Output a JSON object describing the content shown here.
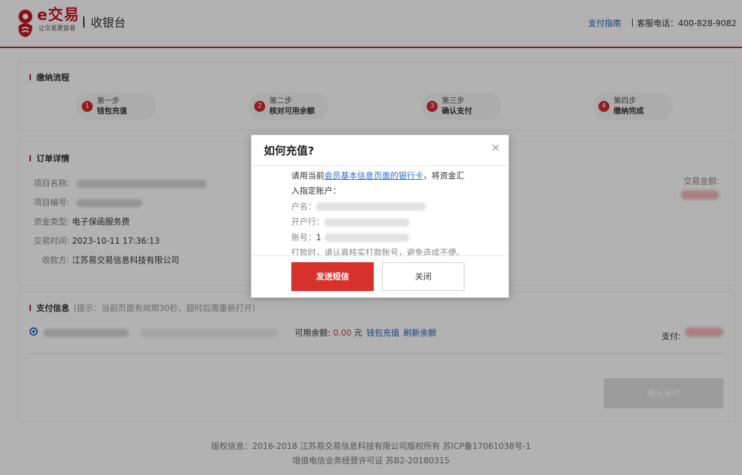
{
  "header": {
    "brand_name": "e交易",
    "brand_slogan": "让交易更容易",
    "page_title": "收银台",
    "guide_link": "支付指南",
    "service_hotline": "客服电话：400-828-9082"
  },
  "steps_section": {
    "title": "缴纳流程",
    "steps": [
      {
        "number": "1",
        "step_label": "第一步",
        "name": "钱包充值"
      },
      {
        "number": "2",
        "step_label": "第二步",
        "name": "核对可用余额"
      },
      {
        "number": "3",
        "step_label": "第三步",
        "name": "确认支付"
      },
      {
        "number": "4",
        "step_label": "第四步",
        "name": "缴纳完成"
      }
    ]
  },
  "order_section": {
    "title": "订单详情",
    "project_name_label": "项目名称:",
    "project_code_label": "项目编号:",
    "fund_type_label": "资金类型:",
    "fund_type_value": "电子保函服务费",
    "trade_time_label": "交易时间:",
    "trade_time_value": "2023-10-11 17:36:13",
    "payee_label": "收款方:",
    "payee_value": "江苏易交易信息科技有限公司",
    "total_amount_label": "交易金额:"
  },
  "payment_section": {
    "title": "支付信息",
    "hint": "(提示：当前页面有效期30秒，超时后需重新打开)",
    "available_label": "可用余额:",
    "available_amount": "0.00",
    "currency": "元",
    "recharge_link": "钱包充值",
    "refresh_link": "刷新余额",
    "pay_label": "支付:",
    "confirm_button": "确认支付"
  },
  "footer": {
    "line1": "版权信息：2016-2018 江苏易交易信息科技有限公司版权所有 苏ICP备17061038号-1",
    "line2": "增值电信业务经营许可证 苏B2-20180315"
  },
  "modal": {
    "title": "如何充值?",
    "close_symbol": "×",
    "intro_before": "请用当前",
    "intro_link": "会员基本信息页面的银行卡",
    "intro_after": "，将资金汇",
    "intro_line2": "入指定账户：",
    "account_name_label": "户名：",
    "bank_label": "开户行：",
    "account_no_label": "账号：",
    "account_no_prefix": "1",
    "notice": "打款时，请认真核实打款账号，避免造成不便。",
    "send_sms_button": "发送短信",
    "close_button": "关闭"
  },
  "colors": {
    "brand_red": "#c8161d",
    "button_red": "#d6312b",
    "link_blue": "#1f6fd6",
    "amount_red": "#e03c3c"
  }
}
